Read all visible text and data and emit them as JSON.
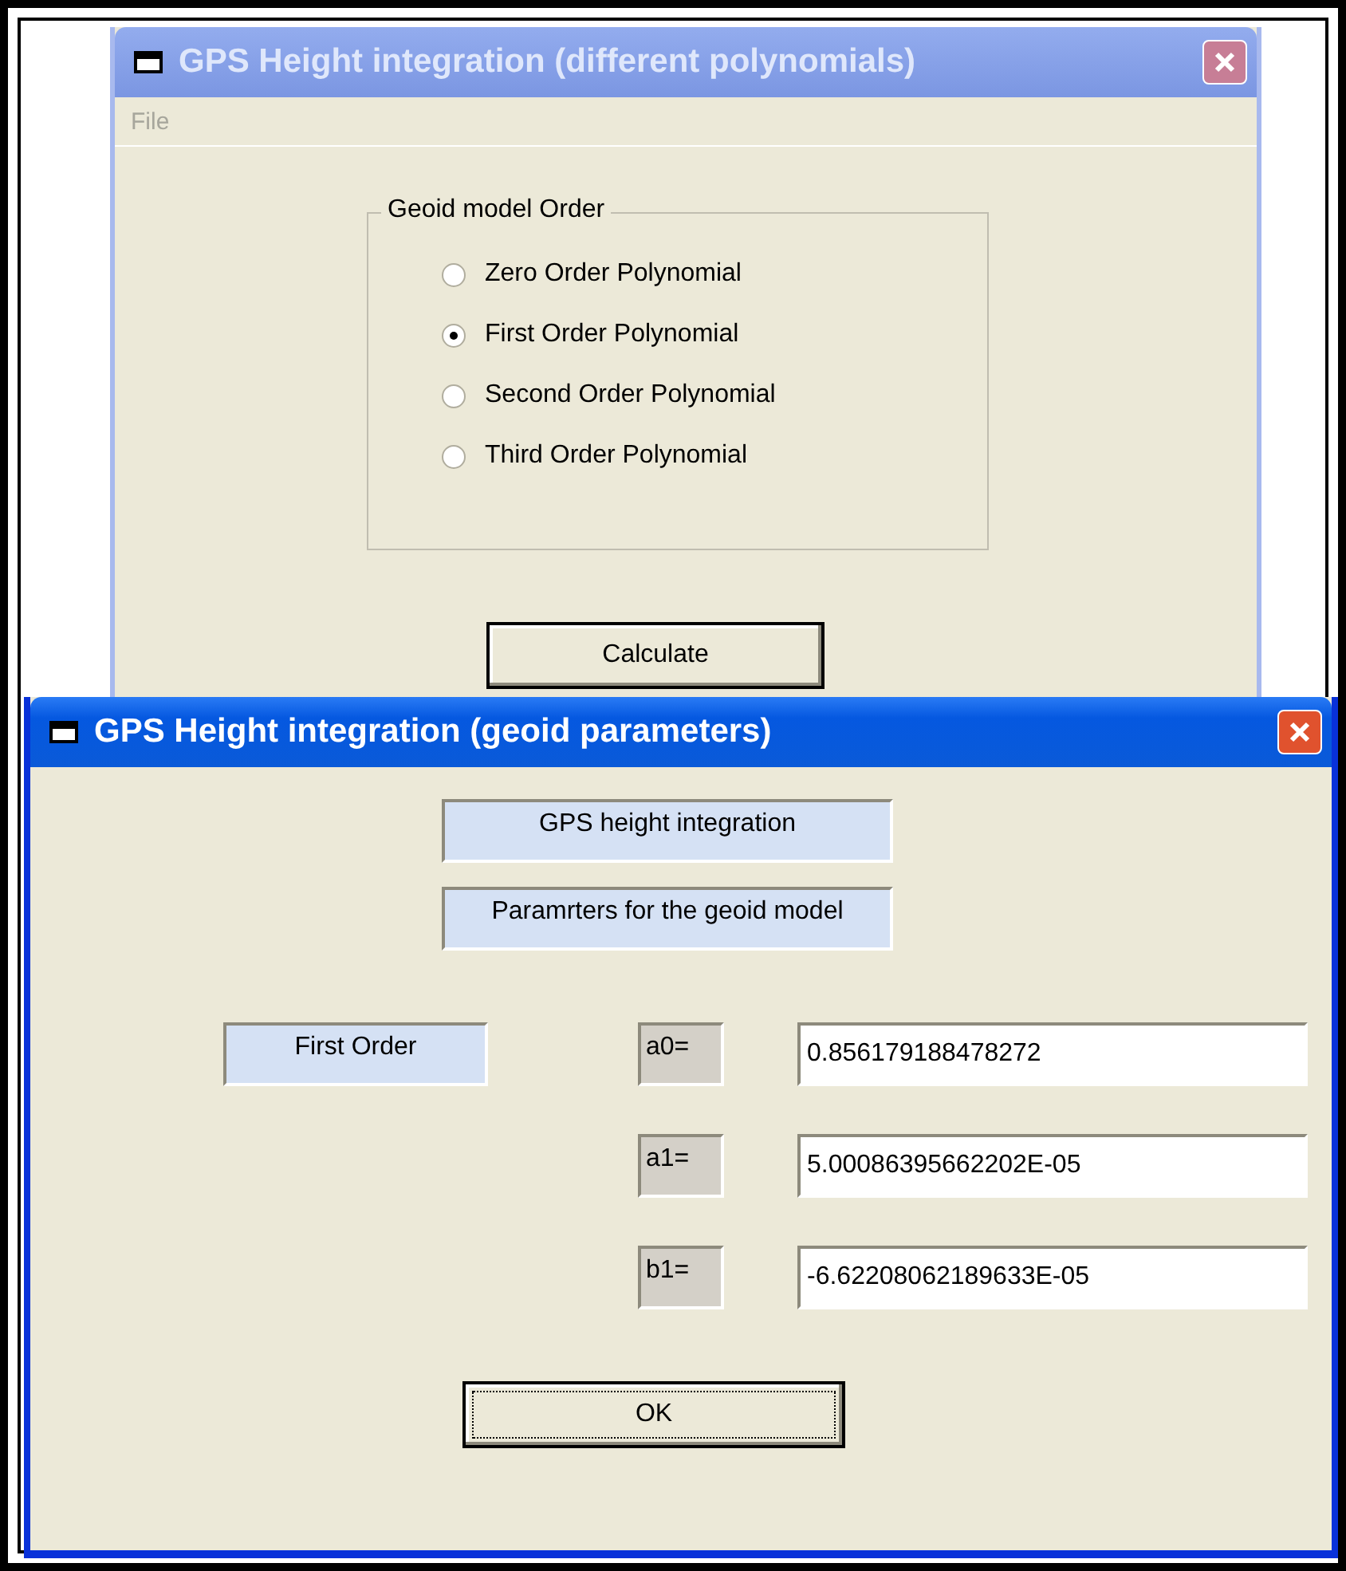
{
  "main_window": {
    "title": "GPS Height integration (different polynomials)",
    "active": false,
    "menu": [
      {
        "label": "File",
        "disabled": true
      }
    ],
    "group": {
      "label": "Geoid model Order",
      "options": [
        {
          "label": "Zero Order Polynomial",
          "selected": false
        },
        {
          "label": "First Order Polynomial",
          "selected": true
        },
        {
          "label": "Second Order Polynomial",
          "selected": false
        },
        {
          "label": "Third Order Polynomial",
          "selected": false
        }
      ]
    },
    "button": "Calculate"
  },
  "result_window": {
    "title": "GPS Height integration (geoid parameters)",
    "active": true,
    "headings": [
      "GPS height integration",
      "Paramrters for the geoid model"
    ],
    "order_label": "First Order",
    "parameters": [
      {
        "name": "a0=",
        "value": "0.856179188478272"
      },
      {
        "name": "a1=",
        "value": "5.00086395662202E-05"
      },
      {
        "name": "b1=",
        "value": "-6.62208062189633E-05"
      }
    ],
    "button": "OK"
  }
}
